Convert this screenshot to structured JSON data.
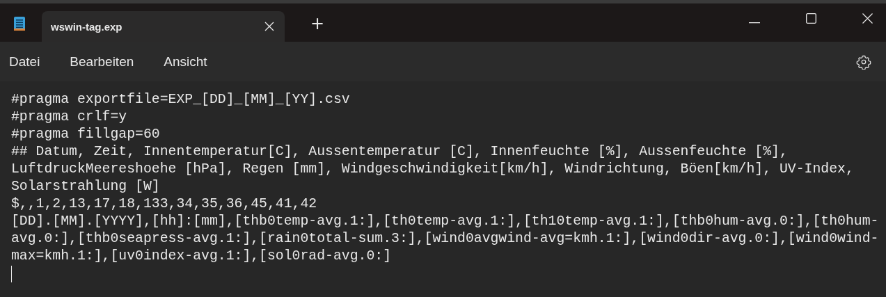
{
  "tabs": [
    {
      "label": "wswin-tag.exp",
      "selected": true
    }
  ],
  "new_tab": {
    "label": "+"
  },
  "menu": [
    {
      "label": "Datei"
    },
    {
      "label": "Bearbeiten"
    },
    {
      "label": "Ansicht"
    }
  ],
  "editor": {
    "lines": [
      "#pragma exportfile=EXP_[DD]_[MM]_[YY].csv",
      "#pragma crlf=y",
      "#pragma fillgap=60",
      "## Datum, Zeit, Innentemperatur[C], Aussentemperatur [C], Innenfeuchte [%], Aussenfeuchte [%],",
      "LuftdruckMeereshoehe [hPa], Regen [mm], Windgeschwindigkeit[km/h], Windrichtung, Böen[km/h], UV-Index,",
      "Solarstrahlung [W]",
      "$,,1,2,13,17,18,133,34,35,36,45,41,42",
      "[DD].[MM].[YYYY],[hh]:[mm],[thb0temp-avg.1:],[th0temp-avg.1:],[th10temp-avg.1:],[thb0hum-avg.0:],[th0hum-",
      "avg.0:],[thb0seapress-avg.1:],[rain0total-sum.3:],[wind0avgwind-avg=kmh.1:],[wind0dir-avg.0:],[wind0wind-",
      "max=kmh.1:],[uv0index-avg.1:],[sol0rad-avg.0:]"
    ]
  }
}
